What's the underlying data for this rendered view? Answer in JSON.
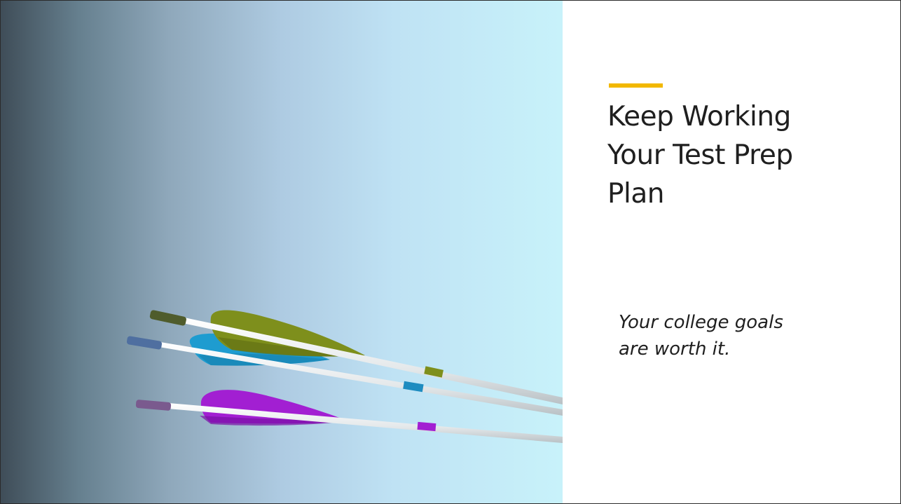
{
  "slide": {
    "title_lines": [
      "Keep Working",
      "Your Test Prep",
      "Plan"
    ],
    "subtitle_lines": [
      "Your college goals",
      "are worth it."
    ]
  },
  "image": {
    "description_icon": "arrows-image",
    "arrows": [
      {
        "name": "green-arrow",
        "fletching_color": "#7e8f1c"
      },
      {
        "name": "blue-arrow",
        "fletching_color": "#1e9cd0"
      },
      {
        "name": "purple-arrow",
        "fletching_color": "#a21fd2"
      }
    ]
  },
  "colors": {
    "accent": "#f2b800",
    "text": "#1f1f1f",
    "background": "#ffffff"
  }
}
